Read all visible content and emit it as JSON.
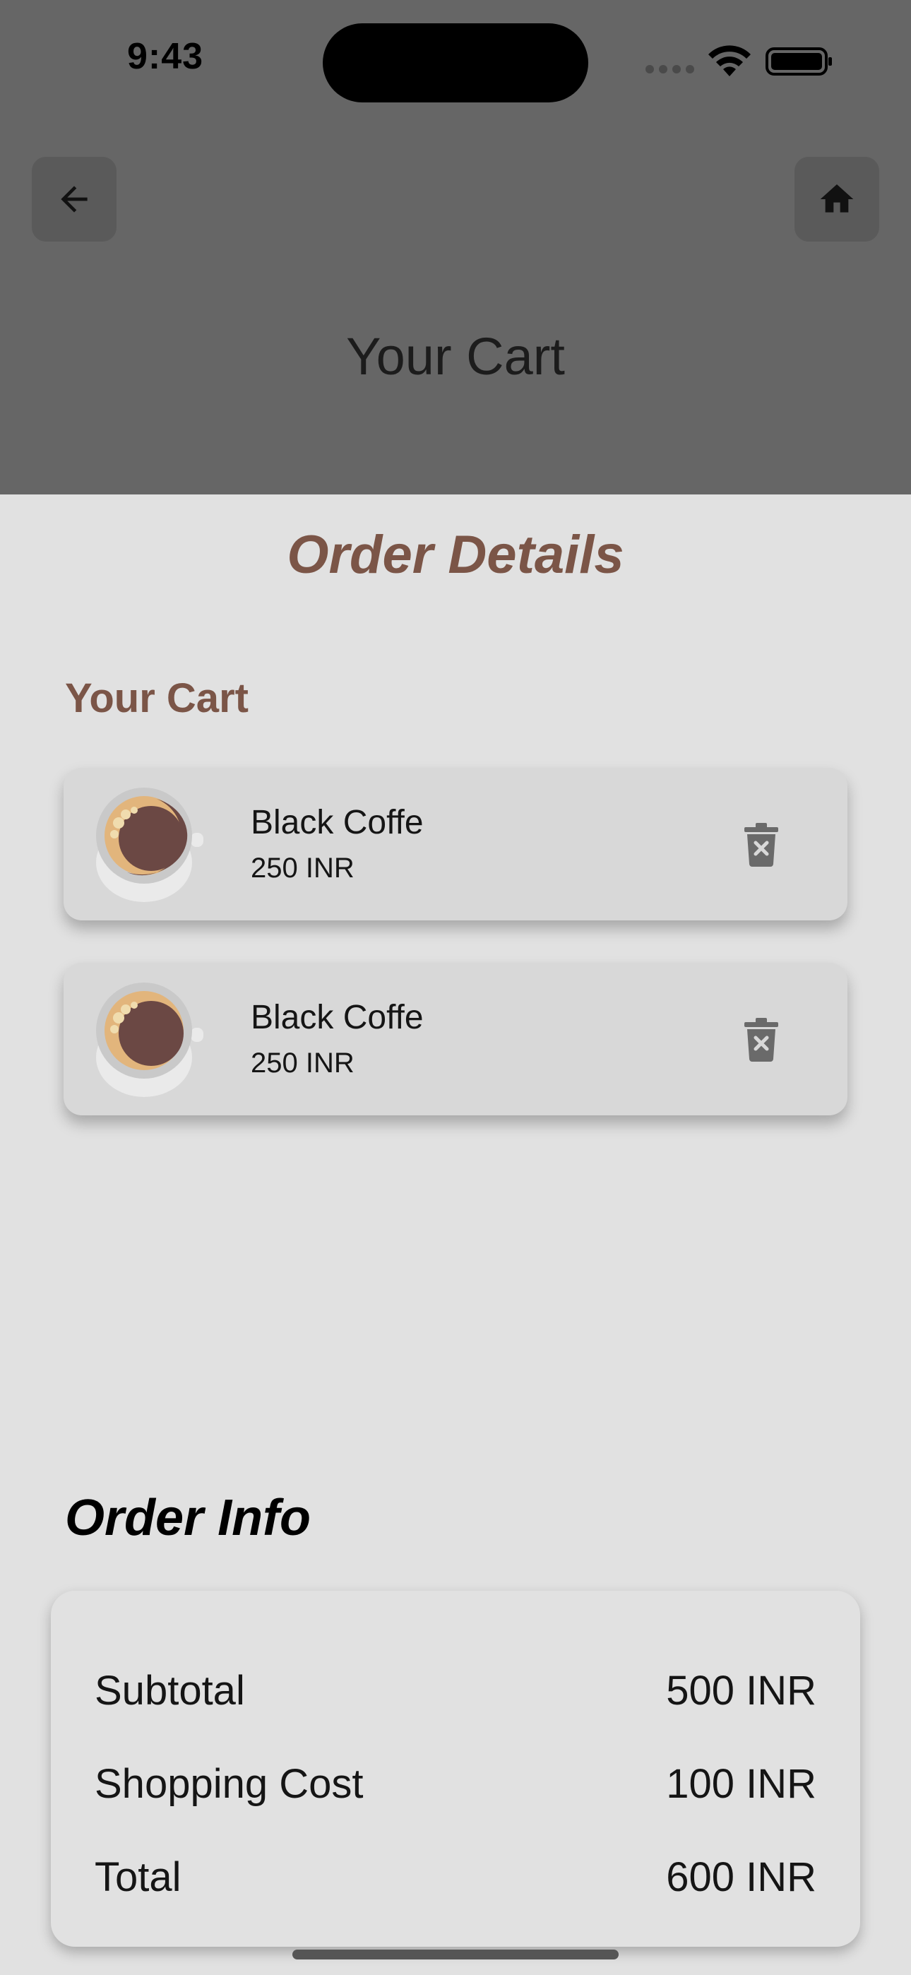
{
  "status": {
    "time": "9:43"
  },
  "header": {
    "title": "Your Cart"
  },
  "sheet": {
    "title": "Order Details",
    "cart_label": "Your Cart"
  },
  "cart": {
    "items": [
      {
        "name": "Black Coffe",
        "price": "250 INR",
        "thumb_icon": "coffee-cup-icon",
        "delete_icon": "trash-icon"
      },
      {
        "name": "Black Coffe",
        "price": "250 INR",
        "thumb_icon": "coffee-cup-icon",
        "delete_icon": "trash-icon"
      }
    ]
  },
  "order_info": {
    "title": "Order Info",
    "subtotal_label": "Subtotal",
    "subtotal_value": "500 INR",
    "shipping_label": "Shopping Cost",
    "shipping_value": "100 INR",
    "total_label": "Total",
    "total_value": "600 INR"
  },
  "colors": {
    "overlay": "#666666",
    "sheet_bg": "#e1e1e1",
    "accent_brown": "#7b5547",
    "card_bg": "#d8d8d8"
  }
}
